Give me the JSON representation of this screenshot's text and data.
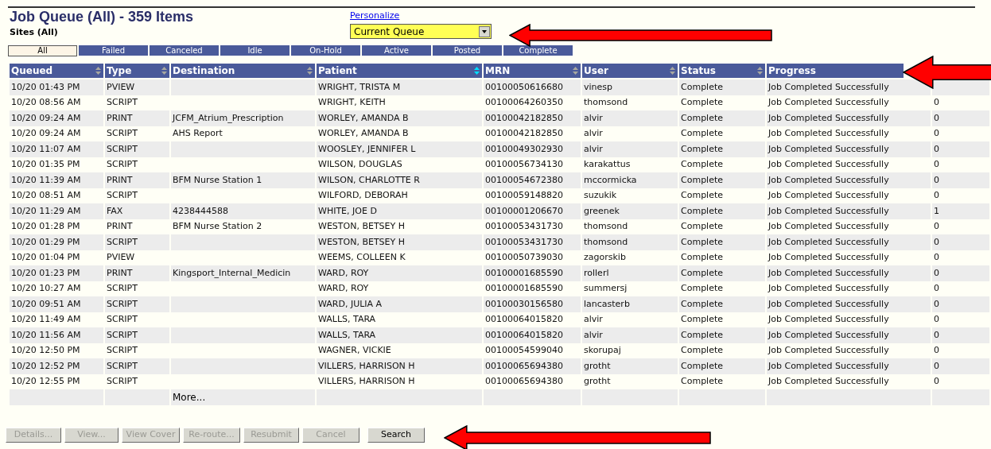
{
  "header": {
    "title": "Job Queue (All) - 359 Items",
    "subtitle": "Sites (All)",
    "personalize_link": "Personalize",
    "queue_select": {
      "value": "Current Queue"
    }
  },
  "tabs": [
    {
      "label": "All",
      "selected": true
    },
    {
      "label": "Failed",
      "selected": false
    },
    {
      "label": "Canceled",
      "selected": false
    },
    {
      "label": "Idle",
      "selected": false
    },
    {
      "label": "On-Hold",
      "selected": false
    },
    {
      "label": "Active",
      "selected": false
    },
    {
      "label": "Posted",
      "selected": false
    },
    {
      "label": "Complete",
      "selected": false
    }
  ],
  "table": {
    "columns": [
      {
        "label": "Queued",
        "sorted": false
      },
      {
        "label": "Type",
        "sorted": false
      },
      {
        "label": "Destination",
        "sorted": false
      },
      {
        "label": "Patient",
        "sorted": true
      },
      {
        "label": "MRN",
        "sorted": false
      },
      {
        "label": "User",
        "sorted": false
      },
      {
        "label": "Status",
        "sorted": false
      },
      {
        "label": "Progress"
      }
    ],
    "rows": [
      {
        "queued": "10/20 01:43 PM",
        "type": "PVIEW",
        "destination": "",
        "patient": "WRIGHT, TRISTA M",
        "mrn": "00100050616680",
        "user": "vinesp",
        "status": "Complete",
        "progress": "Job Completed Successfully"
      },
      {
        "queued": "10/20 08:56 AM",
        "type": "SCRIPT",
        "destination": "",
        "patient": "WRIGHT, KEITH",
        "mrn": "00100064260350",
        "user": "thomsond",
        "status": "Complete",
        "progress": "Job Completed Successfully",
        "column_9": "0"
      },
      {
        "queued": "10/20 09:24 AM",
        "type": "PRINT",
        "destination": "JCFM_Atrium_Prescription",
        "patient": "WORLEY, AMANDA B",
        "mrn": "00100042182850",
        "user": "alvir",
        "status": "Complete",
        "progress": "Job Completed Successfully",
        "column_9": "0"
      },
      {
        "queued": "10/20 09:24 AM",
        "type": "SCRIPT",
        "destination": "AHS Report",
        "patient": "WORLEY, AMANDA B",
        "mrn": "00100042182850",
        "user": "alvir",
        "status": "Complete",
        "progress": "Job Completed Successfully",
        "column_9": "0"
      },
      {
        "queued": "10/20 11:07 AM",
        "type": "SCRIPT",
        "destination": "",
        "patient": "WOOSLEY, JENNIFER L",
        "mrn": "00100049302930",
        "user": "alvir",
        "status": "Complete",
        "progress": "Job Completed Successfully",
        "column_9": "0"
      },
      {
        "queued": "10/20 01:35 PM",
        "type": "SCRIPT",
        "destination": "",
        "patient": "WILSON, DOUGLAS",
        "mrn": "00100056734130",
        "user": "karakattus",
        "status": "Complete",
        "progress": "Job Completed Successfully",
        "column_9": "0"
      },
      {
        "queued": "10/20 11:39 AM",
        "type": "PRINT",
        "destination": "BFM Nurse Station 1",
        "patient": "WILSON, CHARLOTTE R",
        "mrn": "00100054672380",
        "user": "mccormicka",
        "status": "Complete",
        "progress": "Job Completed Successfully",
        "column_9": "0"
      },
      {
        "queued": "10/20 08:51 AM",
        "type": "SCRIPT",
        "destination": "",
        "patient": "WILFORD, DEBORAH",
        "mrn": "00100059148820",
        "user": "suzukik",
        "status": "Complete",
        "progress": "Job Completed Successfully",
        "column_9": "0"
      },
      {
        "queued": "10/20 11:29 AM",
        "type": "FAX",
        "destination": "4238444588",
        "patient": "WHITE, JOE D",
        "mrn": "00100001206670",
        "user": "greenek",
        "status": "Complete",
        "progress": "Job Completed Successfully",
        "column_9": "1"
      },
      {
        "queued": "10/20 01:28 PM",
        "type": "PRINT",
        "destination": "BFM Nurse Station 2",
        "patient": "WESTON, BETSEY H",
        "mrn": "00100053431730",
        "user": "thomsond",
        "status": "Complete",
        "progress": "Job Completed Successfully",
        "column_9": "0"
      },
      {
        "queued": "10/20 01:29 PM",
        "type": "SCRIPT",
        "destination": "",
        "patient": "WESTON, BETSEY H",
        "mrn": "00100053431730",
        "user": "thomsond",
        "status": "Complete",
        "progress": "Job Completed Successfully",
        "column_9": "0"
      },
      {
        "queued": "10/20 01:04 PM",
        "type": "PVIEW",
        "destination": "",
        "patient": "WEEMS, COLLEEN K",
        "mrn": "00100050739030",
        "user": "zagorskib",
        "status": "Complete",
        "progress": "Job Completed Successfully",
        "column_9": "0"
      },
      {
        "queued": "10/20 01:23 PM",
        "type": "PRINT",
        "destination": "Kingsport_Internal_Medicin",
        "patient": "WARD, ROY",
        "mrn": "00100001685590",
        "user": "rollerl",
        "status": "Complete",
        "progress": "Job Completed Successfully",
        "column_9": "0"
      },
      {
        "queued": "10/20 10:27 AM",
        "type": "SCRIPT",
        "destination": "",
        "patient": "WARD, ROY",
        "mrn": "00100001685590",
        "user": "summersj",
        "status": "Complete",
        "progress": "Job Completed Successfully",
        "column_9": "0"
      },
      {
        "queued": "10/20 09:51 AM",
        "type": "SCRIPT",
        "destination": "",
        "patient": "WARD, JULIA A",
        "mrn": "00100030156580",
        "user": "lancasterb",
        "status": "Complete",
        "progress": "Job Completed Successfully",
        "column_9": "0"
      },
      {
        "queued": "10/20 11:49 AM",
        "type": "SCRIPT",
        "destination": "",
        "patient": "WALLS, TARA",
        "mrn": "00100064015820",
        "user": "alvir",
        "status": "Complete",
        "progress": "Job Completed Successfully",
        "column_9": "0"
      },
      {
        "queued": "10/20 11:56 AM",
        "type": "SCRIPT",
        "destination": "",
        "patient": "WALLS, TARA",
        "mrn": "00100064015820",
        "user": "alvir",
        "status": "Complete",
        "progress": "Job Completed Successfully",
        "column_9": "0"
      },
      {
        "queued": "10/20 12:50 PM",
        "type": "SCRIPT",
        "destination": "",
        "patient": "WAGNER, VICKIE",
        "mrn": "00100054599040",
        "user": "skorupaj",
        "status": "Complete",
        "progress": "Job Completed Successfully",
        "column_9": "0"
      },
      {
        "queued": "10/20 12:52 PM",
        "type": "SCRIPT",
        "destination": "",
        "patient": "VILLERS, HARRISON H",
        "mrn": "00100065694380",
        "user": "grotht",
        "status": "Complete",
        "progress": "Job Completed Successfully",
        "column_9": "0"
      },
      {
        "queued": "10/20 12:55 PM",
        "type": "SCRIPT",
        "destination": "",
        "patient": "VILLERS, HARRISON H",
        "mrn": "00100065694380",
        "user": "grotht",
        "status": "Complete",
        "progress": "Job Completed Successfully",
        "column_9": "0"
      }
    ],
    "more_link": "More..."
  },
  "buttons": [
    {
      "label": "Details...",
      "disabled": true
    },
    {
      "label": "View...",
      "disabled": true
    },
    {
      "label": "View Cover",
      "disabled": true
    },
    {
      "label": "Re-route...",
      "disabled": true
    },
    {
      "label": "Resubmit",
      "disabled": true
    },
    {
      "label": "Cancel",
      "disabled": true
    },
    {
      "label": "Search",
      "disabled": false
    }
  ]
}
